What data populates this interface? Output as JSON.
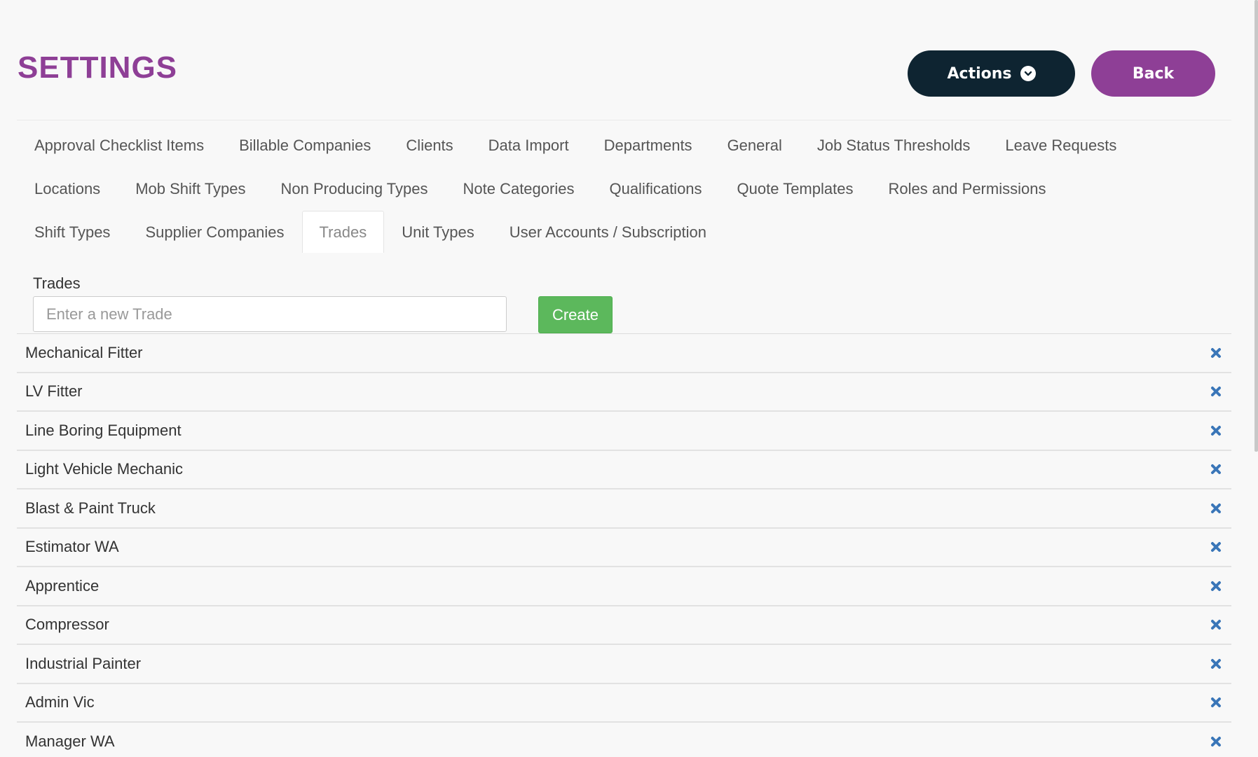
{
  "header": {
    "title": "SETTINGS",
    "actions_label": "Actions",
    "back_label": "Back"
  },
  "tabs": [
    [
      "Approval Checklist Items",
      "Billable Companies",
      "Clients",
      "Data Import",
      "Departments",
      "General",
      "Job Status Thresholds",
      "Leave Requests"
    ],
    [
      "Locations",
      "Mob Shift Types",
      "Non Producing Types",
      "Note Categories",
      "Qualifications",
      "Quote Templates",
      "Roles and Permissions"
    ],
    [
      "Shift Types",
      "Supplier Companies",
      "Trades",
      "Unit Types",
      "User Accounts / Subscription"
    ]
  ],
  "active_tab": "Trades",
  "trades_section": {
    "label": "Trades",
    "input_placeholder": "Enter a new Trade",
    "input_value": "",
    "create_label": "Create"
  },
  "trades": [
    "Mechanical Fitter",
    "LV Fitter",
    "Line Boring Equipment",
    "Light Vehicle Mechanic",
    "Blast & Paint Truck",
    "Estimator WA",
    "Apprentice",
    "Compressor",
    "Industrial Painter",
    "Admin Vic",
    "Manager WA"
  ],
  "icons": {
    "actions": "chevron-down-circle-icon",
    "delete": "close-icon"
  },
  "colors": {
    "brand_purple": "#8e3f96",
    "dark_navy": "#0e2431",
    "create_green": "#5cb85c",
    "delete_blue": "#3a76b8"
  }
}
